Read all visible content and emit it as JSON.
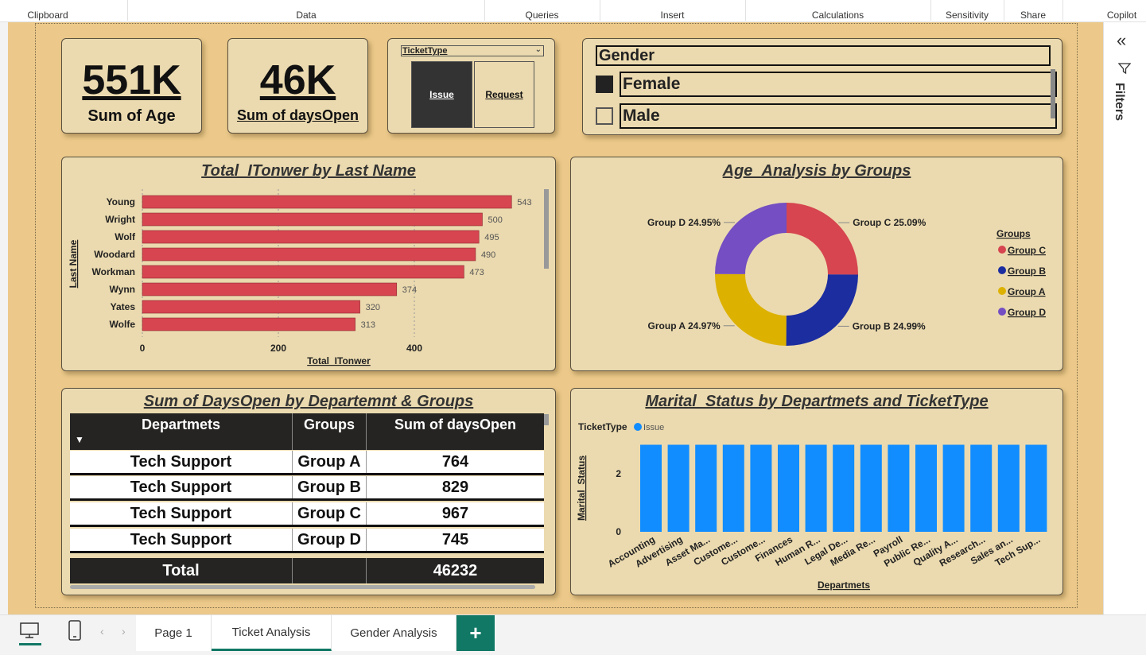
{
  "ribbon": {
    "groups": [
      "Clipboard",
      "Data",
      "Queries",
      "Insert",
      "Calculations",
      "Sensitivity",
      "Share",
      "Copilot"
    ]
  },
  "kpis": [
    {
      "value": "551K",
      "label": "Sum of Age"
    },
    {
      "value": "46K",
      "label": "Sum of daysOpen"
    }
  ],
  "ticket_slicer": {
    "title": "TicketType",
    "options": [
      {
        "label": "Issue",
        "selected": true
      },
      {
        "label": "Request",
        "selected": false
      }
    ]
  },
  "gender_slicer": {
    "title": "Gender",
    "options": [
      {
        "label": "Female",
        "checked": true
      },
      {
        "label": "Male",
        "checked": false
      }
    ]
  },
  "colors": {
    "bar_red": "#d64550",
    "group_c": "#d64550",
    "group_b": "#1c2da0",
    "group_a": "#ddb100",
    "group_d": "#744ec2",
    "issue_blue": "#118dff",
    "card_bg": "#ebdaaf",
    "canvas_bg": "#ecc98a",
    "accent_green": "#117865"
  },
  "bar_visual": {
    "title": "Total_ITonwer by Last Name",
    "chart_data": {
      "type": "bar",
      "orientation": "horizontal",
      "categories": [
        "Young",
        "Wright",
        "Wolf",
        "Woodard",
        "Workman",
        "Wynn",
        "Yates",
        "Wolfe"
      ],
      "values": [
        543,
        500,
        495,
        490,
        473,
        374,
        320,
        313
      ],
      "xlabel": "Total_ITonwer",
      "ylabel": "Last Name",
      "xticks": [
        "0",
        "200",
        "400"
      ],
      "xlim": [
        0,
        600
      ],
      "grid": true
    }
  },
  "donut_visual": {
    "title": "Age_Analysis by Groups",
    "legend_title": "Groups",
    "chart_data": {
      "type": "pie",
      "categories": [
        "Group C",
        "Group B",
        "Group A",
        "Group D"
      ],
      "values": [
        25.09,
        24.99,
        24.97,
        24.95
      ],
      "labels": [
        "Group C 25.09%",
        "Group B 24.99%",
        "Group A 24.97%",
        "Group D 24.95%"
      ],
      "legend": [
        "Group C",
        "Group B",
        "Group A",
        "Group D"
      ],
      "legend_position": "right"
    }
  },
  "table_visual": {
    "title": "Sum of DaysOpen by Departemnt & Groups",
    "columns": [
      "Departmets",
      "Groups",
      "Sum of daysOpen"
    ],
    "rows": [
      [
        "Tech Support",
        "Group A",
        "764"
      ],
      [
        "Tech Support",
        "Group B",
        "829"
      ],
      [
        "Tech Support",
        "Group C",
        "967"
      ],
      [
        "Tech Support",
        "Group D",
        "745"
      ]
    ],
    "total": [
      "Total",
      "",
      "46232"
    ]
  },
  "column_visual": {
    "title": "Marital_Status by Departmets and TicketType",
    "legend_title": "TicketType",
    "chart_data": {
      "type": "bar",
      "categories": [
        "Accounting",
        "Advertising",
        "Asset Ma...",
        "Custome...",
        "Custome...",
        "Finances",
        "Human R...",
        "Legal De...",
        "Media Re...",
        "Payroll",
        "Public Re...",
        "Quality A...",
        "Research...",
        "Sales an...",
        "Tech Sup..."
      ],
      "series": [
        {
          "name": "Issue",
          "values": [
            3,
            3,
            3,
            3,
            3,
            3,
            3,
            3,
            3,
            3,
            3,
            3,
            3,
            3,
            3
          ]
        }
      ],
      "xlabel": "Departmets",
      "ylabel": "Marital_Status",
      "yticks": [
        "0",
        "2"
      ],
      "ylim": [
        0,
        3
      ]
    }
  },
  "filters_pane": {
    "label": "Filters"
  },
  "pages": {
    "tabs": [
      "Page 1",
      "Ticket Analysis",
      "Gender Analysis"
    ],
    "active": "Ticket Analysis"
  }
}
